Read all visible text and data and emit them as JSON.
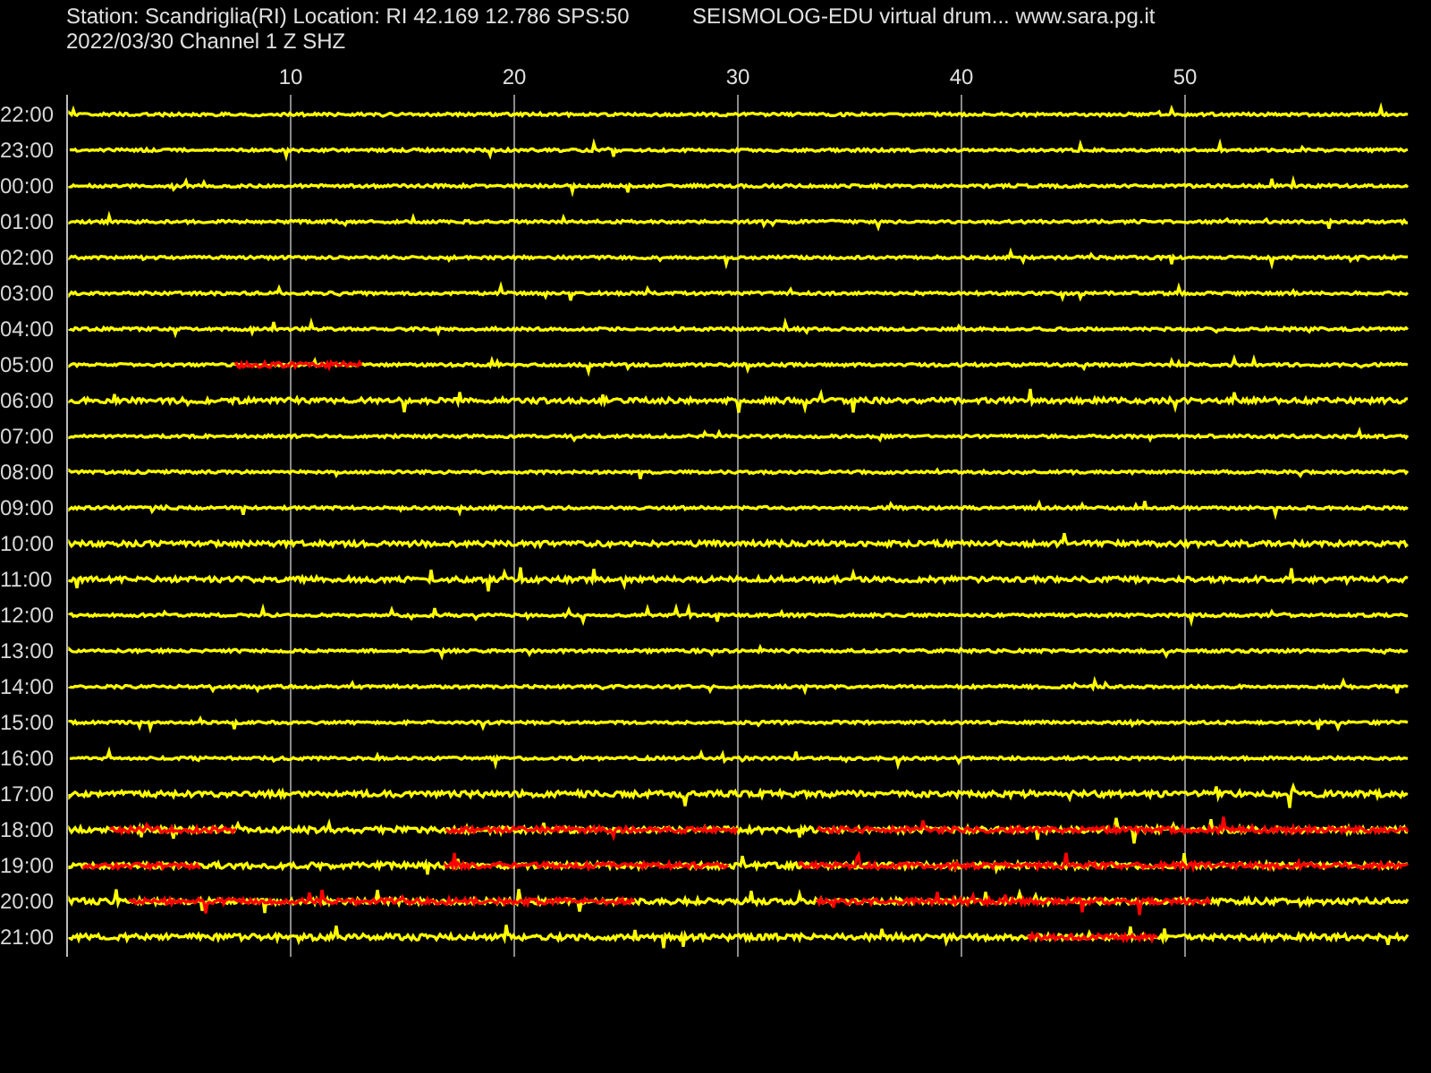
{
  "header": {
    "station_line": "Station: Scandriglia(RI) Location: RI 42.169 12.786 SPS:50",
    "title": "SEISMOLOG-EDU virtual drum... www.sara.pg.it",
    "date_line": "2022/03/30  Channel 1 Z SHZ"
  },
  "minute_ticks": [
    "10",
    "20",
    "30",
    "40",
    "50"
  ],
  "hour_labels": [
    "22:00",
    "23:00",
    "00:00",
    "01:00",
    "02:00",
    "03:00",
    "04:00",
    "05:00",
    "06:00",
    "07:00",
    "08:00",
    "09:00",
    "10:00",
    "11:00",
    "12:00",
    "13:00",
    "14:00",
    "15:00",
    "16:00",
    "17:00",
    "18:00",
    "19:00",
    "20:00",
    "21:00"
  ]
}
